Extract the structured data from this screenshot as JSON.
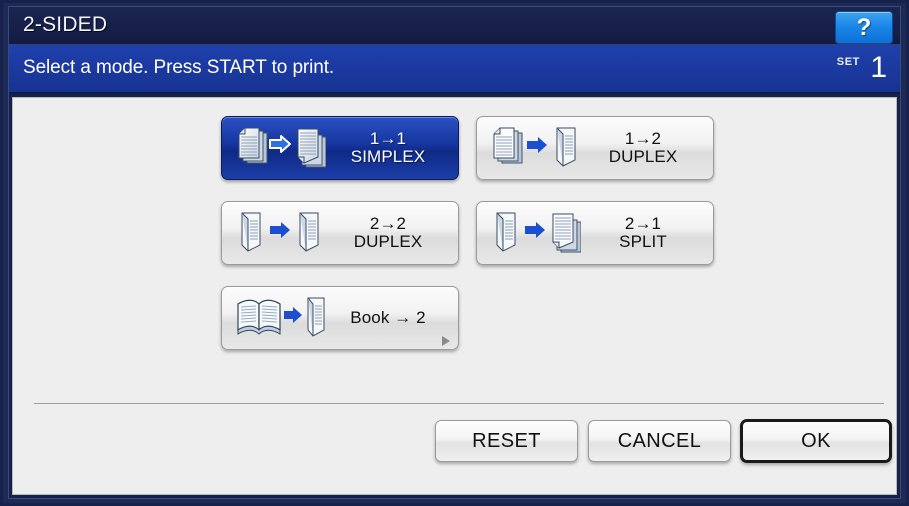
{
  "window": {
    "title": "2-SIDED",
    "help_icon": "question-mark-icon",
    "help_label": "?"
  },
  "message_bar": {
    "text": "Select a mode. Press START to print.",
    "set_label": "SET",
    "set_value": "1"
  },
  "modes": [
    {
      "id": "simplex-1-to-1",
      "line1": "1→1",
      "line2": "SIMPLEX",
      "icon": "sheet-to-sheet-icon",
      "selected": true,
      "has_submenu": false
    },
    {
      "id": "duplex-1-to-2",
      "line1": "1→2",
      "line2": "DUPLEX",
      "icon": "sheet-to-duplex-icon",
      "selected": false,
      "has_submenu": false
    },
    {
      "id": "duplex-2-to-2",
      "line1": "2→2",
      "line2": "DUPLEX",
      "icon": "duplex-to-duplex-icon",
      "selected": false,
      "has_submenu": false
    },
    {
      "id": "split-2-to-1",
      "line1": "2→1",
      "line2": "SPLIT",
      "icon": "duplex-to-sheet-icon",
      "selected": false,
      "has_submenu": false
    },
    {
      "id": "book-to-2",
      "line1": "Book → 2",
      "line2": "",
      "icon": "book-to-duplex-icon",
      "selected": false,
      "has_submenu": true
    }
  ],
  "footer": {
    "reset_label": "RESET",
    "cancel_label": "CANCEL",
    "ok_label": "OK"
  },
  "colors": {
    "titlebar": "#16204a",
    "message_bar": "#1838a0",
    "panel": "#eeeeee",
    "selected_button": "#15349d",
    "help_button": "#1b87e8",
    "arrow_blue": "#1b4fd0"
  }
}
